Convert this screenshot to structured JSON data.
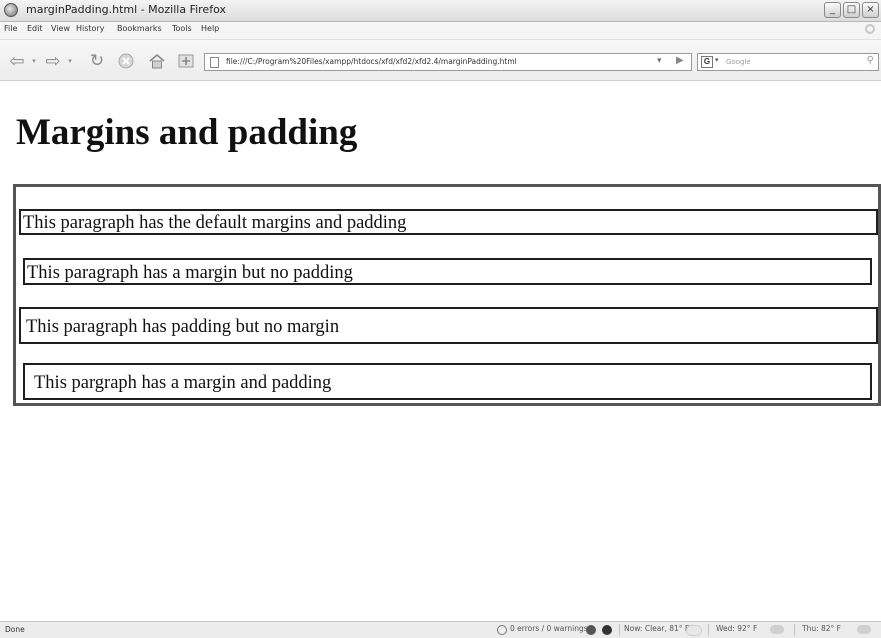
{
  "window": {
    "title": "marginPadding.html - Mozilla Firefox",
    "controls": {
      "minimize": "_",
      "maximize": "□",
      "close": "×"
    }
  },
  "menu": [
    "File",
    "Edit",
    "View",
    "History",
    "Bookmarks",
    "Tools",
    "Help"
  ],
  "toolbar": {
    "url": "file:///C:/Program%20Files/xampp/htdocs/xfd/xfd2/xfd2.4/marginPadding.html",
    "search_engine_glyph": "G",
    "search_placeholder": "Google"
  },
  "page": {
    "heading": "Margins and padding",
    "paragraphs": [
      "This paragraph has the default margins and padding",
      "This paragraph has a margin but no padding",
      "This paragraph has padding but no margin",
      "This pargraph has a margin and padding"
    ]
  },
  "status": {
    "text": "Done",
    "validator": "0 errors / 0 warnings",
    "weather_now": "Now: Clear, 81° F",
    "weather_wed": "Wed: 92° F",
    "weather_thu": "Thu: 82° F"
  },
  "icons": {
    "back": "back-arrow-icon",
    "forward": "forward-arrow-icon",
    "reload": "reload-icon",
    "stop": "stop-icon",
    "home": "home-icon",
    "bookmark": "bookmark-add-icon",
    "page": "page-icon",
    "search": "magnifier-icon"
  }
}
